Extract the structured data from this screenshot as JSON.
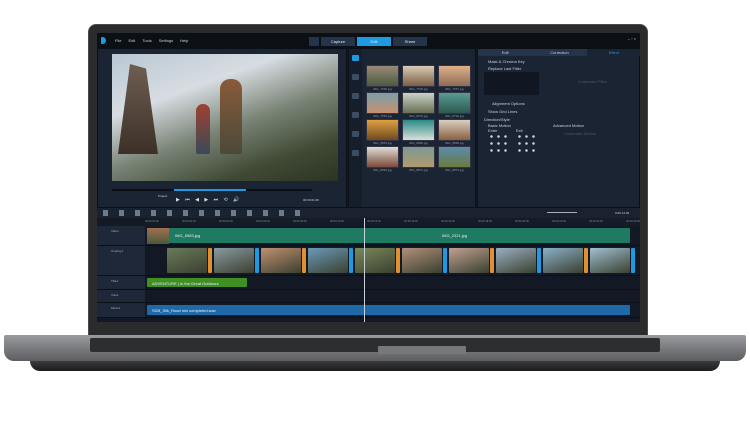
{
  "menu": [
    "File",
    "Edit",
    "Tools",
    "Settings",
    "Help"
  ],
  "workspace_tabs": [
    "Capture",
    "Edit",
    "Share"
  ],
  "active_tab": "Edit",
  "options_tabs": [
    "Edit",
    "Correction",
    "Effect"
  ],
  "options": {
    "mask": "Mask & Chroma Key",
    "replace": "Replace Last Filter",
    "customize": "Customize Filter",
    "alignment": "Alignment Options",
    "grid": "Show Grid Lines",
    "direction": "Direction/Style",
    "basic": "Basic Motion",
    "advanced": "Advanced Motion",
    "enter": "Enter",
    "exit": "Exit",
    "customize_motion": "Customize Motion"
  },
  "player": {
    "mode": "Project",
    "timecode": "00:00:01:08"
  },
  "library": [
    {
      "name": "IMG_7535.jpg",
      "c1": "#9a8a78",
      "c2": "#4b5a40"
    },
    {
      "name": "IMG_7536.jpg",
      "c1": "#d9cbb2",
      "c2": "#7b5e45"
    },
    {
      "name": "IMG_7567.jpg",
      "c1": "#e0b08a",
      "c2": "#8c6c55"
    },
    {
      "name": "IMG_7562.jpg",
      "c1": "#7aa0a8",
      "c2": "#c89070"
    },
    {
      "name": "IMG_8670.jpg",
      "c1": "#c9d2c8",
      "c2": "#6a7052"
    },
    {
      "name": "IMG_8720.jpg",
      "c1": "#5a9b92",
      "c2": "#2a5a50"
    },
    {
      "name": "IMG_8853.jpg",
      "c1": "#e0a040",
      "c2": "#6e4a20"
    },
    {
      "name": "IMG_8860.jpg",
      "c1": "#2b8b86",
      "c2": "#d8e0da"
    },
    {
      "name": "IMG_8868.jpg",
      "c1": "#d8d0c0",
      "c2": "#8a6040"
    },
    {
      "name": "IMG_8991.jpg",
      "c1": "#e0ddd8",
      "c2": "#7a4a38"
    },
    {
      "name": "IMG_8872.jpg",
      "c1": "#7a9a94",
      "c2": "#b49a70"
    },
    {
      "name": "IMG_8873.jpg",
      "c1": "#5a8cae",
      "c2": "#6a7a40"
    }
  ],
  "timeline": {
    "timecode": "0:00:14:00",
    "ruler": [
      "00:00:00:00",
      "00:00:02:00",
      "00:00:04:00",
      "00:00:06:00",
      "00:00:08:00",
      "00:00:10:00",
      "00:00:12:00",
      "00:00:14:00",
      "00:00:16:00",
      "00:00:18:00",
      "00:00:20:00",
      "00:00:22:00",
      "00:00:24:00",
      "00:00:26:00"
    ],
    "tracks": [
      "Video",
      "Overlay1",
      "Title1",
      "Voice",
      "Music1"
    ],
    "video_clips": [
      "IMG_5983.jpg",
      "IMG_2321.jpg"
    ],
    "title_clip": "ADVENTURE | In the Great Outdoors",
    "music_clip": "SDB_Silk_Road mix completed.wav"
  },
  "colors": {
    "accent": "#1e9be0",
    "video": "#1f7a62",
    "title": "#3f8f22",
    "music": "#1e6aa8"
  }
}
